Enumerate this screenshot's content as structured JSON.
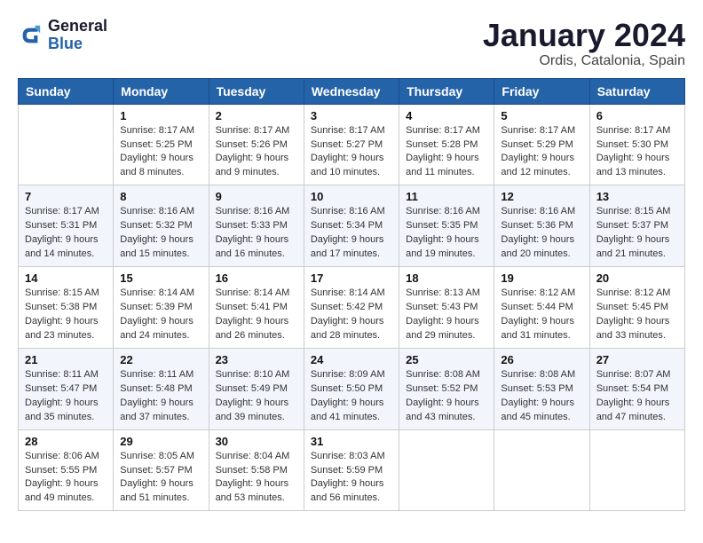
{
  "header": {
    "logo_line1": "General",
    "logo_line2": "Blue",
    "title": "January 2024",
    "subtitle": "Ordis, Catalonia, Spain"
  },
  "columns": [
    "Sunday",
    "Monday",
    "Tuesday",
    "Wednesday",
    "Thursday",
    "Friday",
    "Saturday"
  ],
  "weeks": [
    [
      {
        "day": "",
        "sunrise": "",
        "sunset": "",
        "daylight": ""
      },
      {
        "day": "1",
        "sunrise": "Sunrise: 8:17 AM",
        "sunset": "Sunset: 5:25 PM",
        "daylight": "Daylight: 9 hours and 8 minutes."
      },
      {
        "day": "2",
        "sunrise": "Sunrise: 8:17 AM",
        "sunset": "Sunset: 5:26 PM",
        "daylight": "Daylight: 9 hours and 9 minutes."
      },
      {
        "day": "3",
        "sunrise": "Sunrise: 8:17 AM",
        "sunset": "Sunset: 5:27 PM",
        "daylight": "Daylight: 9 hours and 10 minutes."
      },
      {
        "day": "4",
        "sunrise": "Sunrise: 8:17 AM",
        "sunset": "Sunset: 5:28 PM",
        "daylight": "Daylight: 9 hours and 11 minutes."
      },
      {
        "day": "5",
        "sunrise": "Sunrise: 8:17 AM",
        "sunset": "Sunset: 5:29 PM",
        "daylight": "Daylight: 9 hours and 12 minutes."
      },
      {
        "day": "6",
        "sunrise": "Sunrise: 8:17 AM",
        "sunset": "Sunset: 5:30 PM",
        "daylight": "Daylight: 9 hours and 13 minutes."
      }
    ],
    [
      {
        "day": "7",
        "sunrise": "Sunrise: 8:17 AM",
        "sunset": "Sunset: 5:31 PM",
        "daylight": "Daylight: 9 hours and 14 minutes."
      },
      {
        "day": "8",
        "sunrise": "Sunrise: 8:16 AM",
        "sunset": "Sunset: 5:32 PM",
        "daylight": "Daylight: 9 hours and 15 minutes."
      },
      {
        "day": "9",
        "sunrise": "Sunrise: 8:16 AM",
        "sunset": "Sunset: 5:33 PM",
        "daylight": "Daylight: 9 hours and 16 minutes."
      },
      {
        "day": "10",
        "sunrise": "Sunrise: 8:16 AM",
        "sunset": "Sunset: 5:34 PM",
        "daylight": "Daylight: 9 hours and 17 minutes."
      },
      {
        "day": "11",
        "sunrise": "Sunrise: 8:16 AM",
        "sunset": "Sunset: 5:35 PM",
        "daylight": "Daylight: 9 hours and 19 minutes."
      },
      {
        "day": "12",
        "sunrise": "Sunrise: 8:16 AM",
        "sunset": "Sunset: 5:36 PM",
        "daylight": "Daylight: 9 hours and 20 minutes."
      },
      {
        "day": "13",
        "sunrise": "Sunrise: 8:15 AM",
        "sunset": "Sunset: 5:37 PM",
        "daylight": "Daylight: 9 hours and 21 minutes."
      }
    ],
    [
      {
        "day": "14",
        "sunrise": "Sunrise: 8:15 AM",
        "sunset": "Sunset: 5:38 PM",
        "daylight": "Daylight: 9 hours and 23 minutes."
      },
      {
        "day": "15",
        "sunrise": "Sunrise: 8:14 AM",
        "sunset": "Sunset: 5:39 PM",
        "daylight": "Daylight: 9 hours and 24 minutes."
      },
      {
        "day": "16",
        "sunrise": "Sunrise: 8:14 AM",
        "sunset": "Sunset: 5:41 PM",
        "daylight": "Daylight: 9 hours and 26 minutes."
      },
      {
        "day": "17",
        "sunrise": "Sunrise: 8:14 AM",
        "sunset": "Sunset: 5:42 PM",
        "daylight": "Daylight: 9 hours and 28 minutes."
      },
      {
        "day": "18",
        "sunrise": "Sunrise: 8:13 AM",
        "sunset": "Sunset: 5:43 PM",
        "daylight": "Daylight: 9 hours and 29 minutes."
      },
      {
        "day": "19",
        "sunrise": "Sunrise: 8:12 AM",
        "sunset": "Sunset: 5:44 PM",
        "daylight": "Daylight: 9 hours and 31 minutes."
      },
      {
        "day": "20",
        "sunrise": "Sunrise: 8:12 AM",
        "sunset": "Sunset: 5:45 PM",
        "daylight": "Daylight: 9 hours and 33 minutes."
      }
    ],
    [
      {
        "day": "21",
        "sunrise": "Sunrise: 8:11 AM",
        "sunset": "Sunset: 5:47 PM",
        "daylight": "Daylight: 9 hours and 35 minutes."
      },
      {
        "day": "22",
        "sunrise": "Sunrise: 8:11 AM",
        "sunset": "Sunset: 5:48 PM",
        "daylight": "Daylight: 9 hours and 37 minutes."
      },
      {
        "day": "23",
        "sunrise": "Sunrise: 8:10 AM",
        "sunset": "Sunset: 5:49 PM",
        "daylight": "Daylight: 9 hours and 39 minutes."
      },
      {
        "day": "24",
        "sunrise": "Sunrise: 8:09 AM",
        "sunset": "Sunset: 5:50 PM",
        "daylight": "Daylight: 9 hours and 41 minutes."
      },
      {
        "day": "25",
        "sunrise": "Sunrise: 8:08 AM",
        "sunset": "Sunset: 5:52 PM",
        "daylight": "Daylight: 9 hours and 43 minutes."
      },
      {
        "day": "26",
        "sunrise": "Sunrise: 8:08 AM",
        "sunset": "Sunset: 5:53 PM",
        "daylight": "Daylight: 9 hours and 45 minutes."
      },
      {
        "day": "27",
        "sunrise": "Sunrise: 8:07 AM",
        "sunset": "Sunset: 5:54 PM",
        "daylight": "Daylight: 9 hours and 47 minutes."
      }
    ],
    [
      {
        "day": "28",
        "sunrise": "Sunrise: 8:06 AM",
        "sunset": "Sunset: 5:55 PM",
        "daylight": "Daylight: 9 hours and 49 minutes."
      },
      {
        "day": "29",
        "sunrise": "Sunrise: 8:05 AM",
        "sunset": "Sunset: 5:57 PM",
        "daylight": "Daylight: 9 hours and 51 minutes."
      },
      {
        "day": "30",
        "sunrise": "Sunrise: 8:04 AM",
        "sunset": "Sunset: 5:58 PM",
        "daylight": "Daylight: 9 hours and 53 minutes."
      },
      {
        "day": "31",
        "sunrise": "Sunrise: 8:03 AM",
        "sunset": "Sunset: 5:59 PM",
        "daylight": "Daylight: 9 hours and 56 minutes."
      },
      {
        "day": "",
        "sunrise": "",
        "sunset": "",
        "daylight": ""
      },
      {
        "day": "",
        "sunrise": "",
        "sunset": "",
        "daylight": ""
      },
      {
        "day": "",
        "sunrise": "",
        "sunset": "",
        "daylight": ""
      }
    ]
  ]
}
